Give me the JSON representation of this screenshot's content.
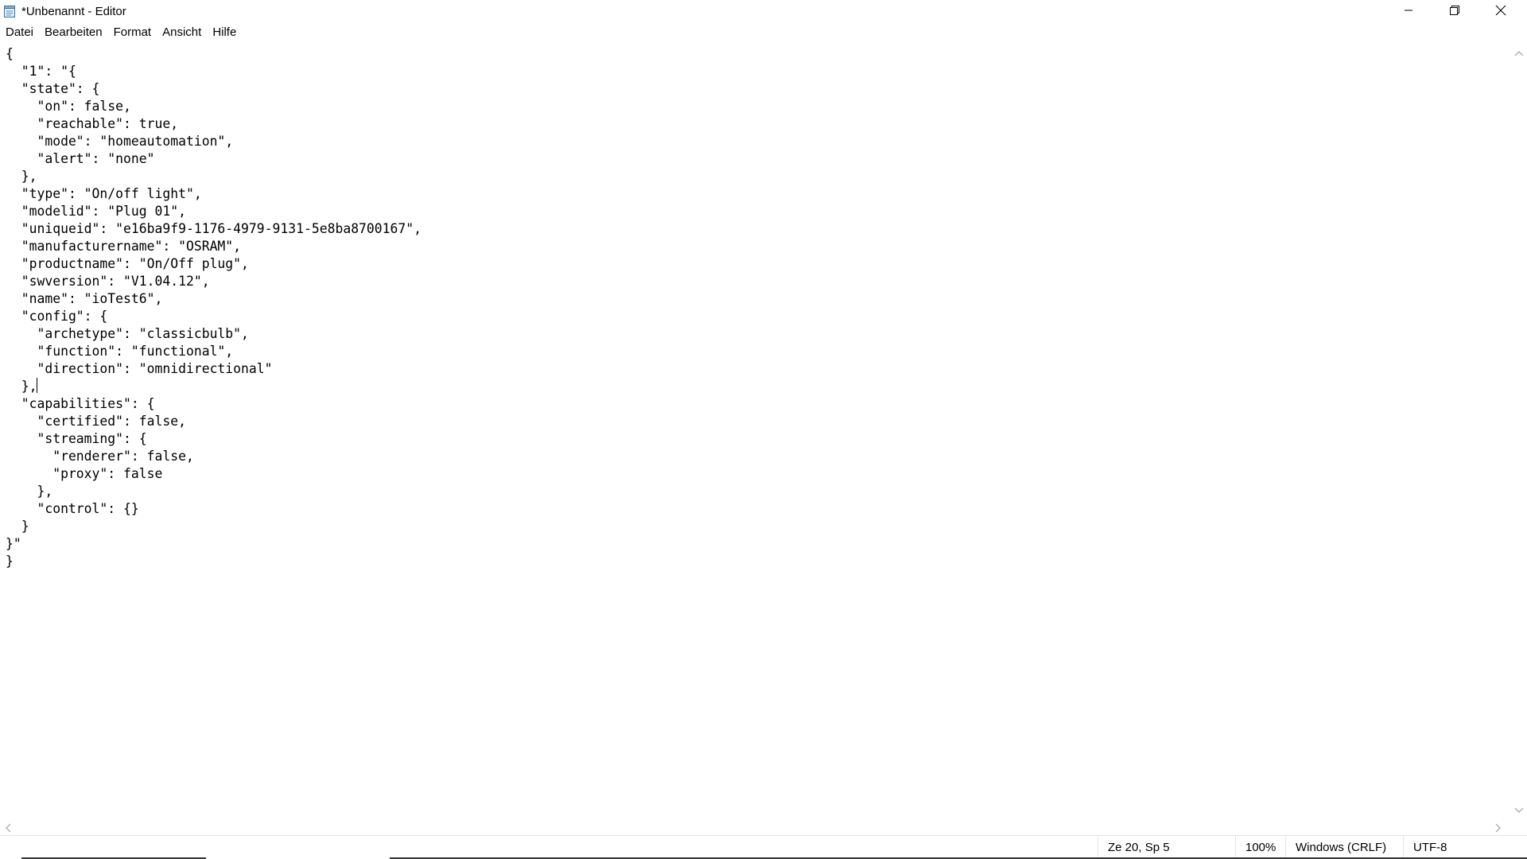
{
  "window": {
    "title": "*Unbenannt - Editor"
  },
  "menu": {
    "items": [
      {
        "label": "Datei"
      },
      {
        "label": "Bearbeiten"
      },
      {
        "label": "Format"
      },
      {
        "label": "Ansicht"
      },
      {
        "label": "Hilfe"
      }
    ]
  },
  "editor": {
    "lines_before_caret": "{\n  \"1\": \"{\n  \"state\": {\n    \"on\": false,\n    \"reachable\": true,\n    \"mode\": \"homeautomation\",\n    \"alert\": \"none\"\n  },\n  \"type\": \"On/off light\",\n  \"modelid\": \"Plug 01\",\n  \"uniqueid\": \"e16ba9f9-1176-4979-9131-5e8ba8700167\",\n  \"manufacturername\": \"OSRAM\",\n  \"productname\": \"On/Off plug\",\n  \"swversion\": \"V1.04.12\",\n  \"name\": \"ioTest6\",\n  \"config\": {\n    \"archetype\": \"classicbulb\",\n    \"function\": \"functional\",\n    \"direction\": \"omnidirectional\"\n  },",
    "lines_after_caret": "\n  \"capabilities\": {\n    \"certified\": false,\n    \"streaming\": {\n      \"renderer\": false,\n      \"proxy\": false\n    },\n    \"control\": {}\n  }\n}\"\n}"
  },
  "status": {
    "position": "Ze 20, Sp 5",
    "zoom": "100%",
    "line_ending": "Windows (CRLF)",
    "encoding": "UTF-8"
  },
  "icons": {
    "app": "notepad-icon",
    "minimize": "minimize-icon",
    "maximize": "restore-icon",
    "close": "close-icon"
  }
}
